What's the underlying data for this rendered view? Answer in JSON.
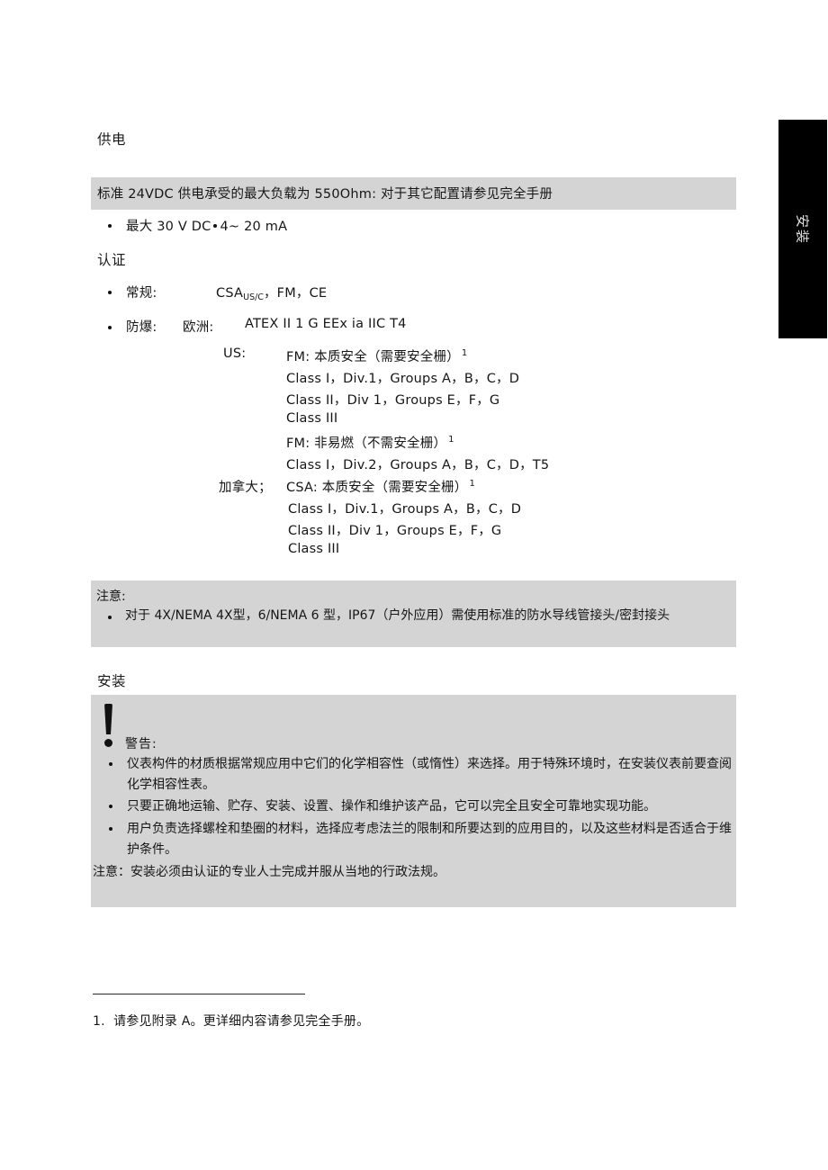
{
  "side_tab": {
    "label": "安装",
    "color": "#000000"
  },
  "sections": {
    "power": {
      "heading": "供电",
      "band_text": "标准 24VDC 供电承受的最大负载为 550Ohm: 对于其它配置请参见完全手册",
      "bullet_a": "最大 30 V DC",
      "bullet_b": "4~ 20 mA"
    },
    "cert": {
      "heading": "认证",
      "general_label": "常规:",
      "general_value_prefix": "CSA",
      "general_value_sub": "US/C",
      "general_value_suffix": "，FM，CE",
      "ex_label": "防爆:",
      "europe_label": "欧洲:",
      "europe_value": "ATEX II 1 G EEx ia IIC T4",
      "us_label": "US:",
      "us_lines": [
        {
          "text": "FM: 本质安全（需要安全栅）",
          "footnote": "1"
        },
        {
          "text": "Class I，Div.1，Groups A，B，C，D",
          "footnote": ""
        },
        {
          "text": "Class II，Div 1，Groups E，F，G",
          "footnote": ""
        },
        {
          "text": "Class III",
          "footnote": ""
        },
        {
          "text": "FM: 非易燃（不需安全栅）",
          "footnote": "1"
        },
        {
          "text": "Class I，Div.2，Groups A，B，C，D，T5",
          "footnote": ""
        }
      ],
      "canada_label": "加拿大；",
      "canada_head": "CSA: 本质安全（需要安全栅）",
      "canada_head_footnote": "1",
      "canada_lines": [
        "Class I，Div.1，Groups A，B，C，D",
        "Class II，Div 1，Groups E，F，G",
        "Class III"
      ]
    },
    "note": {
      "title": "注意:",
      "body": "对于 4X/NEMA 4X型，6/NEMA 6 型，IP67（户外应用）需使用标准的防水导线管接头/密封接头"
    },
    "install": {
      "heading": "安装",
      "warning_title": "警告:",
      "warning_icon": "exclamation-icon",
      "items": [
        "仪表构件的材质根据常规应用中它们的化学相容性（或惰性）来选择。用于特殊环境时，在安装仪表前要查阅化学相容性表。",
        "只要正确地运输、贮存、安装、设置、操作和维护该产品，它可以完全且安全可靠地实现功能。",
        "用户负责选择螺栓和垫圈的材料，选择应考虑法兰的限制和所要达到的应用目的，以及这些材料是否适合于维护条件。"
      ],
      "footer": "注意：安装必须由认证的专业人士完成并服从当地的行政法规。"
    }
  },
  "footnote": {
    "number": "1.",
    "text": "请参见附录 A。更详细内容请参见完全手册。"
  }
}
